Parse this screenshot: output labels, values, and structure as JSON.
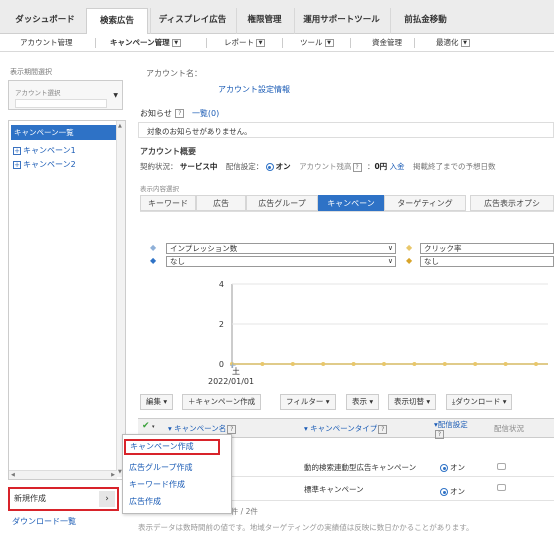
{
  "top_tabs": [
    {
      "label": "ダッシュボード"
    },
    {
      "label": "検索広告"
    },
    {
      "label": "ディスプレイ広告"
    },
    {
      "label": "権限管理"
    },
    {
      "label": "運用サポートツール"
    },
    {
      "label": "前払金移動"
    }
  ],
  "sub_nav": {
    "account_mgmt": "アカウント管理",
    "campaign_mgmt": "キャンペーン管理",
    "report": "レポート",
    "tools": "ツール",
    "funds_mgmt": "資金管理",
    "optimization": "最適化",
    "dropdown_icon": "chevron-down-icon"
  },
  "left_panel": {
    "display_range_label": "表示期間選択",
    "account_select_placeholder": "アカウント選択",
    "tree_header": "キャンペーン一覧",
    "campaigns": [
      "キャンペーン1",
      "キャンペーン2"
    ],
    "new_create_label": "新規作成",
    "new_create_arrow": "›",
    "download_list_label": "ダウンロード一覧"
  },
  "new_menu": {
    "items": [
      "キャンペーン作成",
      "広告グループ作成",
      "キーワード作成",
      "広告作成"
    ]
  },
  "main": {
    "account_name_label": "アカウント名：",
    "account_settings_link": "アカウント設定情報",
    "notice_label": "お知らせ",
    "notice_help": "?",
    "notice_list_link": "一覧(0)",
    "notice_text": "対象のお知らせがありません。",
    "overview_title": "アカウント概要",
    "contract_status_label": "契約状況：",
    "contract_status_value": "サービス中",
    "delivery_setting_label": "配信設定：",
    "delivery_setting_value": "オン",
    "account_period_label": "アカウント残高",
    "account_balance_value": "0円",
    "deposit_link": "入金",
    "forecast_label": "掲載終了までの予想日数",
    "display_content_label": "表示内容選択"
  },
  "content_tabs": [
    "キーワード",
    "広告",
    "広告グループ",
    "キャンペーン",
    "ターゲティング",
    "広告表示オプシ"
  ],
  "chart_data": {
    "type": "line",
    "x": [
      "2022/01/01"
    ],
    "series": [
      {
        "name": "インプレッション数",
        "values": [
          0
        ],
        "color": "#8fb0d8"
      },
      {
        "name": "クリック率",
        "values": [
          0
        ],
        "color": "#e9c76a"
      }
    ],
    "selectors": {
      "left_primary": "インプレッション数",
      "left_secondary": "なし",
      "right_primary": "クリック率",
      "right_secondary": "なし"
    },
    "y_ticks": [
      "4",
      "2",
      "0"
    ],
    "ylim": [
      0,
      4
    ],
    "x_tick_day": "土",
    "x_tick_date": "2022/01/01"
  },
  "toolbar": {
    "edit": "編集",
    "create_campaign": "キャンペーン作成",
    "filter": "フィルター",
    "display": "表示",
    "display_switch": "表示切替",
    "download": "ダウンロード"
  },
  "table": {
    "headers": {
      "name": "キャンペーン名",
      "type": "キャンペーンタイプ",
      "delivery": "配信設定",
      "status": "配信状況"
    },
    "rows": [
      {
        "type": "動的検索連動型広告キャンペーン",
        "delivery": "オン"
      },
      {
        "type": "標準キャンペーン",
        "delivery": "オン"
      }
    ],
    "count_text": "2件 / 2件",
    "footer_note": "表示データは数時間前の値です。地域ターゲティングの実績値は反映に数日かかることがあります。"
  },
  "colors": {
    "accent": "#2e72c6",
    "highlight": "#d8232a",
    "link": "#1a5bb5"
  }
}
